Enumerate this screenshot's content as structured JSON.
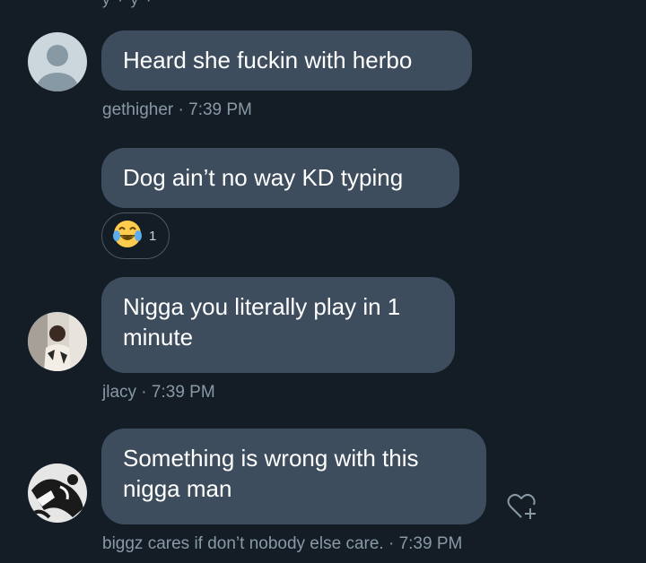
{
  "colors": {
    "background": "#141d26",
    "bubble": "#3d4d5d",
    "meta_text": "#8899a6"
  },
  "top_fragment": "y · y ·",
  "messages": [
    {
      "text": "Heard she fuckin with herbo",
      "author": "gethigher",
      "time": "7:39 PM",
      "avatar": "default-profile-avatar"
    },
    {
      "text": "Dog ain’t no way KD typing",
      "reaction": {
        "emoji": "😂",
        "count": "1"
      }
    },
    {
      "text": "Nigga you literally play in 1\nminute",
      "author": "jlacy",
      "time": "7:39 PM",
      "avatar": "photo-avatar"
    },
    {
      "text": "Something is wrong with this\nnigga man",
      "author": "biggz cares if don’t nobody else care.",
      "time": "7:39 PM",
      "avatar": "artwork-avatar",
      "action_icon": "heart-plus-icon"
    }
  ]
}
